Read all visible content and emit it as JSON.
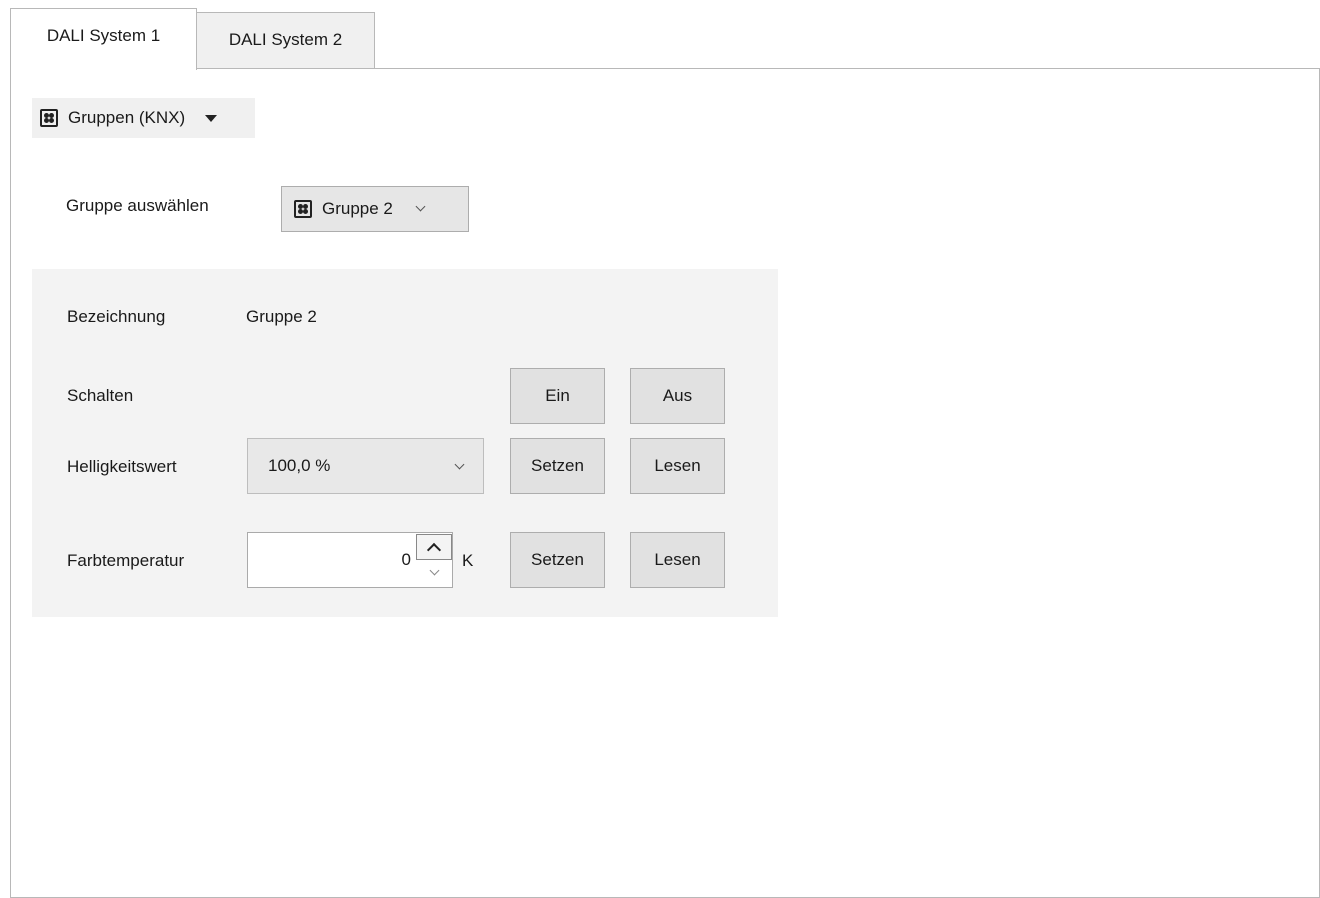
{
  "tabs": [
    {
      "label": "DALI System 1",
      "active": true
    },
    {
      "label": "DALI System 2",
      "active": false
    }
  ],
  "view_selector": {
    "label": "Gruppen (KNX)",
    "icon": "grid-icon"
  },
  "group_select": {
    "label": "Gruppe auswählen",
    "value": "Gruppe 2",
    "icon": "grid-icon"
  },
  "details": {
    "name_label": "Bezeichnung",
    "name_value": "Gruppe 2",
    "switch_label": "Schalten",
    "on_button": "Ein",
    "off_button": "Aus",
    "brightness_label": "Helligkeitswert",
    "brightness_value": "100,0 %",
    "set_button": "Setzen",
    "read_button": "Lesen",
    "color_temp_label": "Farbtemperatur",
    "color_temp_value": "0",
    "color_temp_unit": "K"
  },
  "colors": {
    "section_bg": "#f3f3f3",
    "button_bg": "#e1e1e1",
    "border": "#adadad"
  }
}
